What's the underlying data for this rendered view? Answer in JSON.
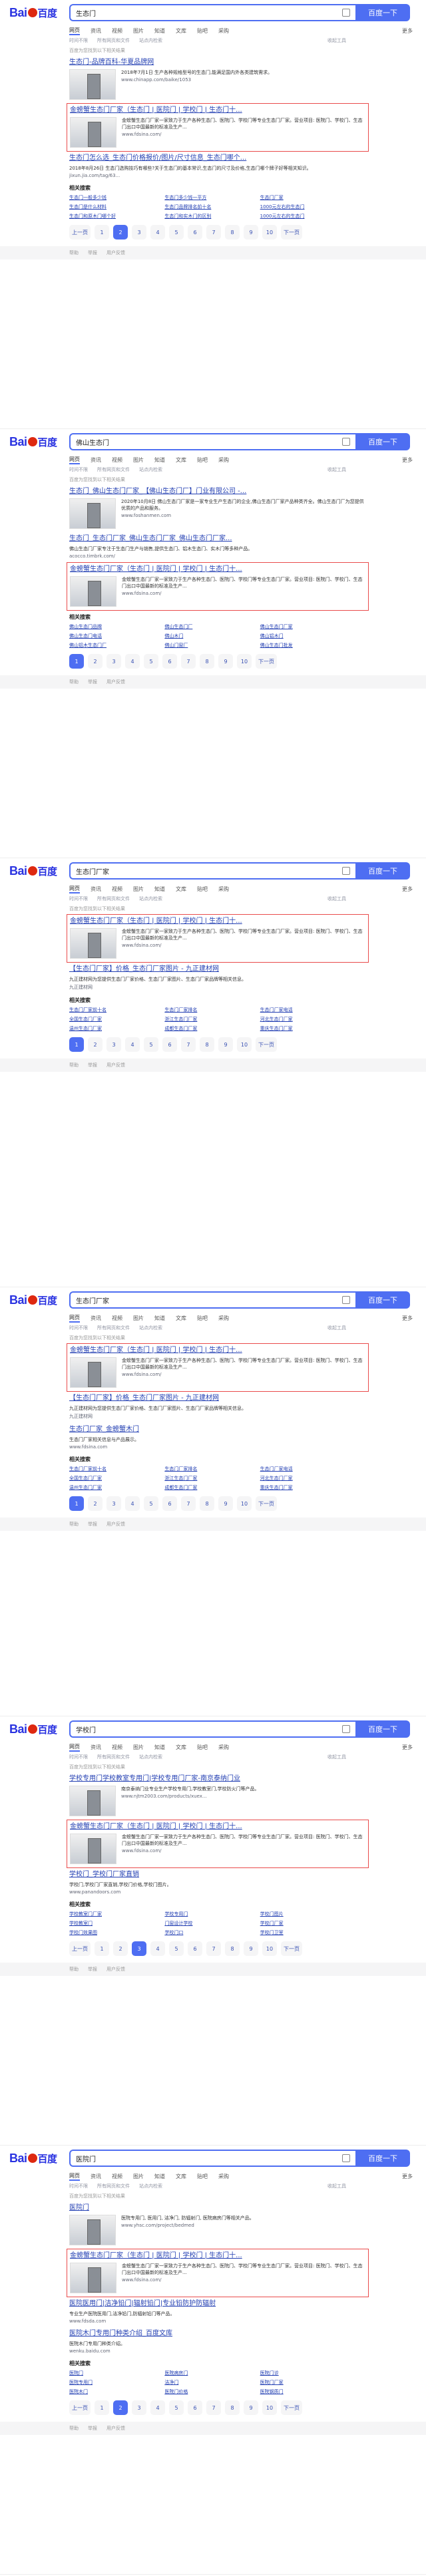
{
  "logo": "Bai百度",
  "btn": "百度一下",
  "tabs": [
    "网页",
    "资讯",
    "视频",
    "图片",
    "知道",
    "文库",
    "贴吧",
    "采购",
    "更多"
  ],
  "tools": [
    "时间不限",
    "所有网页和文件",
    "站点内检索",
    "收起工具"
  ],
  "hint": "百度为您找到以下相关结果",
  "footer": [
    "帮助",
    "举报",
    "用户反馈"
  ],
  "shots": [
    {
      "query": "生态门",
      "results": [
        {
          "title": "生态门-品牌百科-华夏品牌网",
          "desc": "2018年7月1日 生产各种规格型号的生态门,能满足国内外各类建筑需求。",
          "url": "www.chinapp.com/baike/1053",
          "hl": false
        },
        {
          "title": "金螃蟹生态门厂家（生态门 | 医院门 | 学校门 | 生态门十...",
          "desc": "金螃蟹生态门厂家一家致力于生产各种生态门、医院门、学校门等专业生态门厂家。营业项目: 医院门、学校门、生态门出口中国最新的标准及生产...",
          "url": "www.fdsina.com/",
          "hl": true
        },
        {
          "title": "生态门怎么选_生态门价格报价/图片/尺寸信息_生态门哪个...",
          "desc": "2018年8月26日 生态门选购技巧有哪些?关于生态门的基本常识,生态门的尺寸及价格,生态门哪个牌子好等相关知识。",
          "url": "jixun.jia.com/tag/63...",
          "hl": false
        }
      ],
      "related": [
        "生态门一般多少钱",
        "生态门多少钱一平方",
        "生态门厂家",
        "生态门是什么材料",
        "生态门品牌排名前十名",
        "1000元左右的生态门",
        "生态门和原木门哪个好",
        "生态门和实木门的区别",
        "1000元左右的生态门"
      ],
      "pages": [
        "上一页",
        "1",
        "2",
        "3",
        "4",
        "5",
        "6",
        "7",
        "8",
        "9",
        "10",
        "下一页"
      ],
      "cur": 2
    },
    {
      "query": "佛山生态门",
      "results": [
        {
          "title": "生态门_佛山生态门厂家_【佛山生态门厂】门业有限公司 -...",
          "desc": "2020年10月8日 佛山生态门厂家是一家专业生产生态门的企业,佛山生态门厂家产品种类齐全。佛山生态门厂为您提供优质的产品和服务。",
          "url": "www.foshanmen.com",
          "hl": false
        },
        {
          "title": "生态门_生态门厂家_佛山生态门厂家_佛山生态门厂家...",
          "desc": "佛山生态门厂家专注于生态门生产与销售,提供生态门、铝木生态门、实木门等多种产品。",
          "url": "acocco.timbrk.com/",
          "hl": false
        },
        {
          "title": "金螃蟹生态门厂家（生态门 | 医院门 | 学校门 | 生态门十...",
          "desc": "金螃蟹生态门厂家一家致力于生产各种生态门、医院门、学校门等专业生态门厂家。营业项目: 医院门、学校门、生态门出口中国最新的标准及生产...",
          "url": "www.fdsina.com/",
          "hl": true
        }
      ],
      "related": [
        "佛山生态门品牌",
        "佛山生态门厂",
        "佛山生态门厂家",
        "佛山生态门电话",
        "佛山木门",
        "佛山铝木门",
        "佛山铝木生态门厂",
        "佛山门窗厂",
        "佛山生态门批发"
      ],
      "pages": [
        "1",
        "2",
        "3",
        "4",
        "5",
        "6",
        "7",
        "8",
        "9",
        "10",
        "下一页"
      ],
      "cur": 1
    },
    {
      "query": "生态门厂家",
      "results": [
        {
          "title": "金螃蟹生态门厂家（生态门 | 医院门 | 学校门 | 生态门十...",
          "desc": "金螃蟹生态门厂家一家致力于生产各种生态门、医院门、学校门等专业生态门厂家。营业项目: 医院门、学校门、生态门出口中国最新的标准及生产...",
          "url": "www.fdsina.com/",
          "hl": true
        },
        {
          "title": "【生态门厂家】价格_生态门厂家图片 - 九正建材网",
          "desc": "九正建材网为您提供生态门厂家价格、生态门厂家图片、生态门厂家品牌等相关信息。",
          "url": "九正建材网",
          "hl": false
        }
      ],
      "related": [
        "生态门厂家前十名",
        "生态门厂家排名",
        "生态门厂家电话",
        "全国生态门厂家",
        "浙江生态门厂家",
        "河北生态门厂家",
        "温州生态门厂家",
        "成都生态门厂家",
        "重庆生态门厂家"
      ],
      "pages": [
        "1",
        "2",
        "3",
        "4",
        "5",
        "6",
        "7",
        "8",
        "9",
        "10",
        "下一页"
      ],
      "cur": 1
    },
    {
      "query": "生态门厂家",
      "results": [
        {
          "title": "金螃蟹生态门厂家（生态门 | 医院门 | 学校门 | 生态门十...",
          "desc": "金螃蟹生态门厂家一家致力于生产各种生态门、医院门、学校门等专业生态门厂家。营业项目: 医院门、学校门、生态门出口中国最新的标准及生产...",
          "url": "www.fdsina.com/",
          "hl": true
        },
        {
          "title": "【生态门厂家】价格_生态门厂家图片 - 九正建材网",
          "desc": "九正建材网为您提供生态门厂家价格、生态门厂家图片、生态门厂家品牌等相关信息。",
          "url": "九正建材网",
          "hl": false
        },
        {
          "title": "生态门厂家_金螃蟹木门",
          "desc": "生态门厂家相关信息与产品展示。",
          "url": "www.fdsina.com",
          "hl": false
        }
      ],
      "related": [
        "生态门厂家前十名",
        "生态门厂家排名",
        "生态门厂家电话",
        "全国生态门厂家",
        "浙江生态门厂家",
        "河北生态门厂家",
        "温州生态门厂家",
        "成都生态门厂家",
        "重庆生态门厂家"
      ],
      "pages": [
        "1",
        "2",
        "3",
        "4",
        "5",
        "6",
        "7",
        "8",
        "9",
        "10",
        "下一页"
      ],
      "cur": 1
    },
    {
      "query": "学校门",
      "results": [
        {
          "title": "学校专用门学校教室专用门|学校专用门厂家-南京泰纳门业",
          "desc": "南京泰纳门业专业生产学校专用门,学校教室门,学校防火门等产品。",
          "url": "www.njtm2003.com/products/xuex...",
          "hl": false
        },
        {
          "title": "金螃蟹生态门厂家（生态门 | 医院门 | 学校门 | 生态门十...",
          "desc": "金螃蟹生态门厂家一家致力于生产各种生态门、医院门、学校门等专业生态门厂家。营业项目: 医院门、学校门、生态门出口中国最新的标准及生产...",
          "url": "www.fdsina.com/",
          "hl": true
        },
        {
          "title": "学校门_学校门厂家直销",
          "desc": "学校门,学校门厂家直销,学校门价格,学校门图片。",
          "url": "www.panandoors.com",
          "hl": false
        }
      ],
      "related": [
        "学校教室门厂家",
        "学校专用门",
        "学校门图片",
        "学校教室门",
        "门窗设计学校",
        "学校门厂家",
        "学校门效果图",
        "学校门口",
        "学校门卫室"
      ],
      "pages": [
        "上一页",
        "1",
        "2",
        "3",
        "4",
        "5",
        "6",
        "7",
        "8",
        "9",
        "10",
        "下一页"
      ],
      "cur": 3
    },
    {
      "query": "医院门",
      "results": [
        {
          "title": "医院门",
          "desc": "医院专用门, 医用门, 洁净门, 防辐射门, 医院病房门等相关产品。",
          "url": "www.yhsc.com/project/bedmed",
          "hl": false
        },
        {
          "title": "金螃蟹生态门厂家（生态门 | 医院门 | 学校门 | 生态门十...",
          "desc": "金螃蟹生态门厂家一家致力于生产各种生态门、医院门、学校门等专业生态门厂家。营业项目: 医院门、学校门、生态门出口中国最新的标准及生产...",
          "url": "www.fdsina.com/",
          "hl": true
        },
        {
          "title": "医院医用门|洁净铅门|辐射铅门|专业铅防护防辐射",
          "desc": "专业生产医院医用门,洁净铅门,防辐射铅门等产品。",
          "url": "www.fdsda.com",
          "hl": false
        },
        {
          "title": "医院木门专用门种类介绍_百度文库",
          "desc": "医院木门专用门种类介绍。",
          "url": "wenku.baidu.com",
          "hl": false
        }
      ],
      "related": [
        "医院门",
        "医院病房门",
        "医院门诊",
        "医院专用门",
        "洁净门",
        "医院门厂家",
        "医院木门",
        "医院门价格",
        "医院钢质门"
      ],
      "pages": [
        "上一页",
        "1",
        "2",
        "3",
        "4",
        "5",
        "6",
        "7",
        "8",
        "9",
        "10",
        "下一页"
      ],
      "cur": 2
    }
  ]
}
